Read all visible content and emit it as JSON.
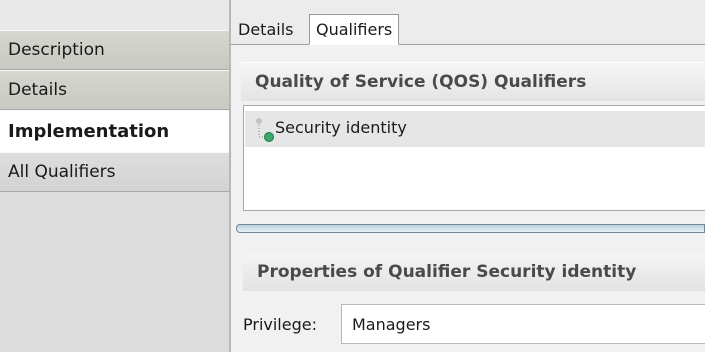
{
  "sidebar": {
    "items": [
      {
        "label": "Description",
        "active": false
      },
      {
        "label": "Details",
        "active": false
      },
      {
        "label": "Implementation",
        "active": true
      },
      {
        "label": "All Qualifiers",
        "active": false
      }
    ]
  },
  "tabs": [
    {
      "label": "Details",
      "active": false
    },
    {
      "label": "Qualifiers",
      "active": true
    }
  ],
  "qos_section": {
    "title": "Quality of Service (QOS) Qualifiers",
    "items": [
      {
        "label": "Security identity",
        "icon": "qualifier-node-icon",
        "selected": true
      }
    ]
  },
  "properties_section": {
    "title": "Properties of Qualifier Security identity",
    "fields": [
      {
        "label": "Privilege:",
        "value": "Managers"
      }
    ]
  },
  "colors": {
    "sidebar_bg": "#dcdcdc",
    "selection_bg": "#e6e6e6",
    "splitter": "#bcd2dc",
    "icon_green": "#3aa86b"
  }
}
